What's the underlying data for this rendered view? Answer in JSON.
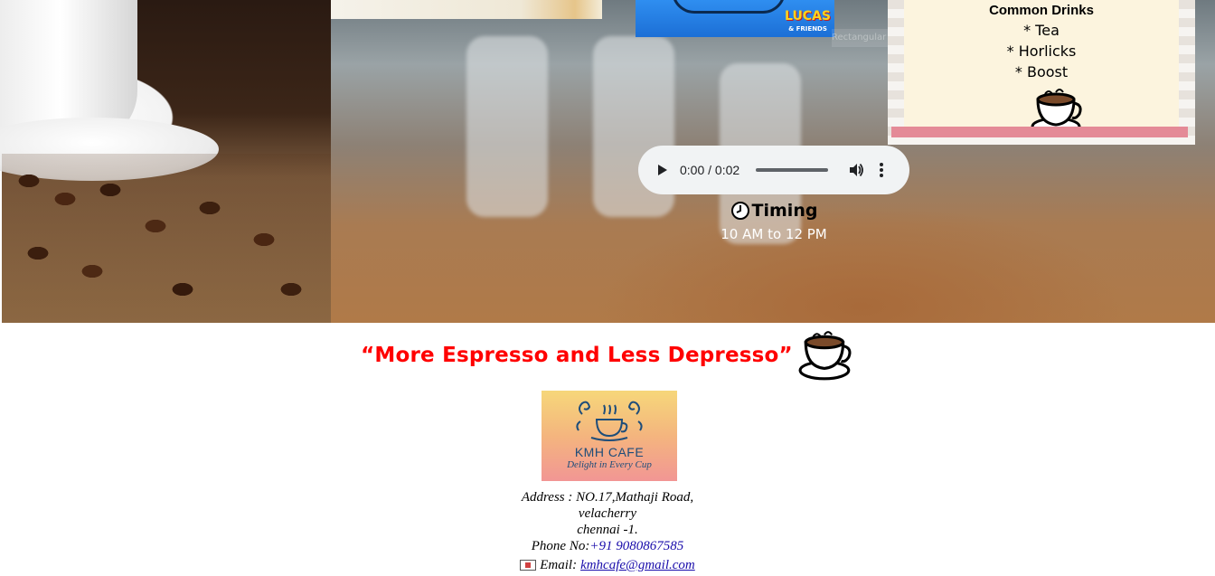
{
  "hero": {
    "cartoon_badge": "LUCAS",
    "cartoon_badge_sub": "& FRIENDS",
    "ghost_text": "Rectangular Strip"
  },
  "drinks": {
    "title": "Common Drinks",
    "items": [
      "* Tea",
      "* Horlicks",
      "* Boost"
    ]
  },
  "audio": {
    "time": "0:00 / 0:02",
    "progress": 0
  },
  "timing": {
    "title": "Timing",
    "hours": "10 AM to 12 PM"
  },
  "quote": {
    "text": "“More Espresso and Less Depresso”"
  },
  "logo": {
    "name": "KMH CAFE",
    "tagline": "Delight in Every Cup"
  },
  "contact": {
    "address_line1": "Address : NO.17,Mathaji Road,",
    "address_line2": "velacherry",
    "address_line3": "chennai -1.",
    "phone_label": "Phone No:",
    "phone_value": "+91 9080867585",
    "email_label": "Email:",
    "email_value": "kmhcafe@gmail.com"
  },
  "colors": {
    "quote": "#ff0000",
    "link": "#1a0dab",
    "drinks_card": "#fcf4de",
    "drinks_strip": "#e48a97"
  }
}
